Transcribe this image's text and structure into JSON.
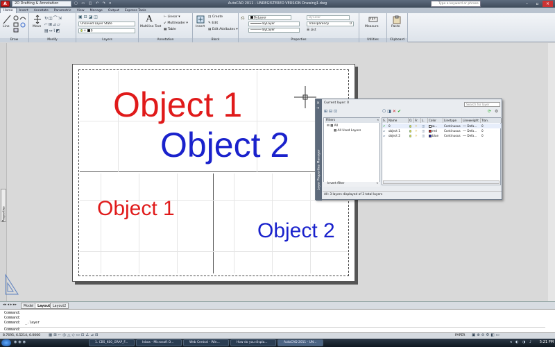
{
  "titlebar": {
    "title": "AutoCAD 2011 - UNREGISTERED VERSION    Drawing1.dwg",
    "workspace": "2D Drafting & Annotation",
    "search_placeholder": "Type a keyword or phrase",
    "app_button": "A"
  },
  "tabs": [
    "Home",
    "Insert",
    "Annotate",
    "Parametric",
    "View",
    "Manage",
    "Output",
    "Express Tools"
  ],
  "ribbon": {
    "draw": {
      "title": "Draw",
      "line": "Line"
    },
    "modify": {
      "title": "Modify",
      "move": "Move"
    },
    "layers": {
      "title": "Layers",
      "state": "Unsaved Layer State",
      "current": "0"
    },
    "annotation": {
      "title": "Annotation",
      "mtext": "Multiline Text",
      "linear": "Linear",
      "multileader": "Multileader",
      "table": "Table"
    },
    "block": {
      "title": "Block",
      "insert": "Insert",
      "create": "Create",
      "edit": "Edit",
      "edit_attributes": "Edit Attributes"
    },
    "properties": {
      "title": "Properties",
      "color": "ByLayer",
      "linetype": "ByLayer",
      "lineweight": "ByLayer",
      "transparency": "Transparency",
      "transparency_value": "0",
      "list": "List"
    },
    "utilities": {
      "title": "Utilities",
      "measure": "Measure"
    },
    "clipboard": {
      "title": "Clipboard",
      "paste": "Paste"
    }
  },
  "drawing": {
    "top_object1": "Object 1",
    "top_object2": "Object 2",
    "bottom_object1": "Object 1",
    "bottom_object2": "Object 2",
    "color_object1": "#e01a1a",
    "color_object2": "#1a22cc",
    "properties_tab": "Properties"
  },
  "layer_manager": {
    "side_title": "Layer Properties Manager",
    "current_layer": "Current layer: 0",
    "search_placeholder": "Search for layer",
    "filters_label": "Filters",
    "tree_all": "All",
    "tree_used": "All Used Layers",
    "invert_filter": "Invert filter",
    "status": "All: 3 layers displayed of 3 total layers",
    "columns": [
      "S.",
      "Name",
      "O.",
      "Fr.",
      "L.",
      "Color",
      "Linetype",
      "Lineweight",
      "Tran."
    ],
    "rows": [
      {
        "status": "✔",
        "name": "0",
        "color_name": "w...",
        "color_hex": "#ffffff",
        "linetype": "Continuous",
        "lineweight": "Defa...",
        "trans": "0"
      },
      {
        "status": "",
        "name": "object 1",
        "color_name": "red",
        "color_hex": "#e01a1a",
        "linetype": "Continuous",
        "lineweight": "Defa...",
        "trans": "0"
      },
      {
        "status": "",
        "name": "object 2",
        "color_name": "blue",
        "color_hex": "#1a22cc",
        "linetype": "Continuous",
        "lineweight": "Defa...",
        "trans": "0"
      }
    ]
  },
  "layout_tabs": [
    "Model",
    "Layout1",
    "Layout2"
  ],
  "command_line": [
    "Command:",
    "Command:",
    "Command:  _.layer",
    "Command:"
  ],
  "status_bar": {
    "coords": "8.7695, 6.5214, 0.0000",
    "space": "PAPER"
  },
  "taskbar": {
    "items": [
      "1. CBS_K00_GRAP_F...",
      "Inbox - Microsoft O...",
      "Web Central - Win...",
      "How do you displa...",
      "AutoCAD 2011 - UN..."
    ],
    "clock": "5:21 PM"
  }
}
